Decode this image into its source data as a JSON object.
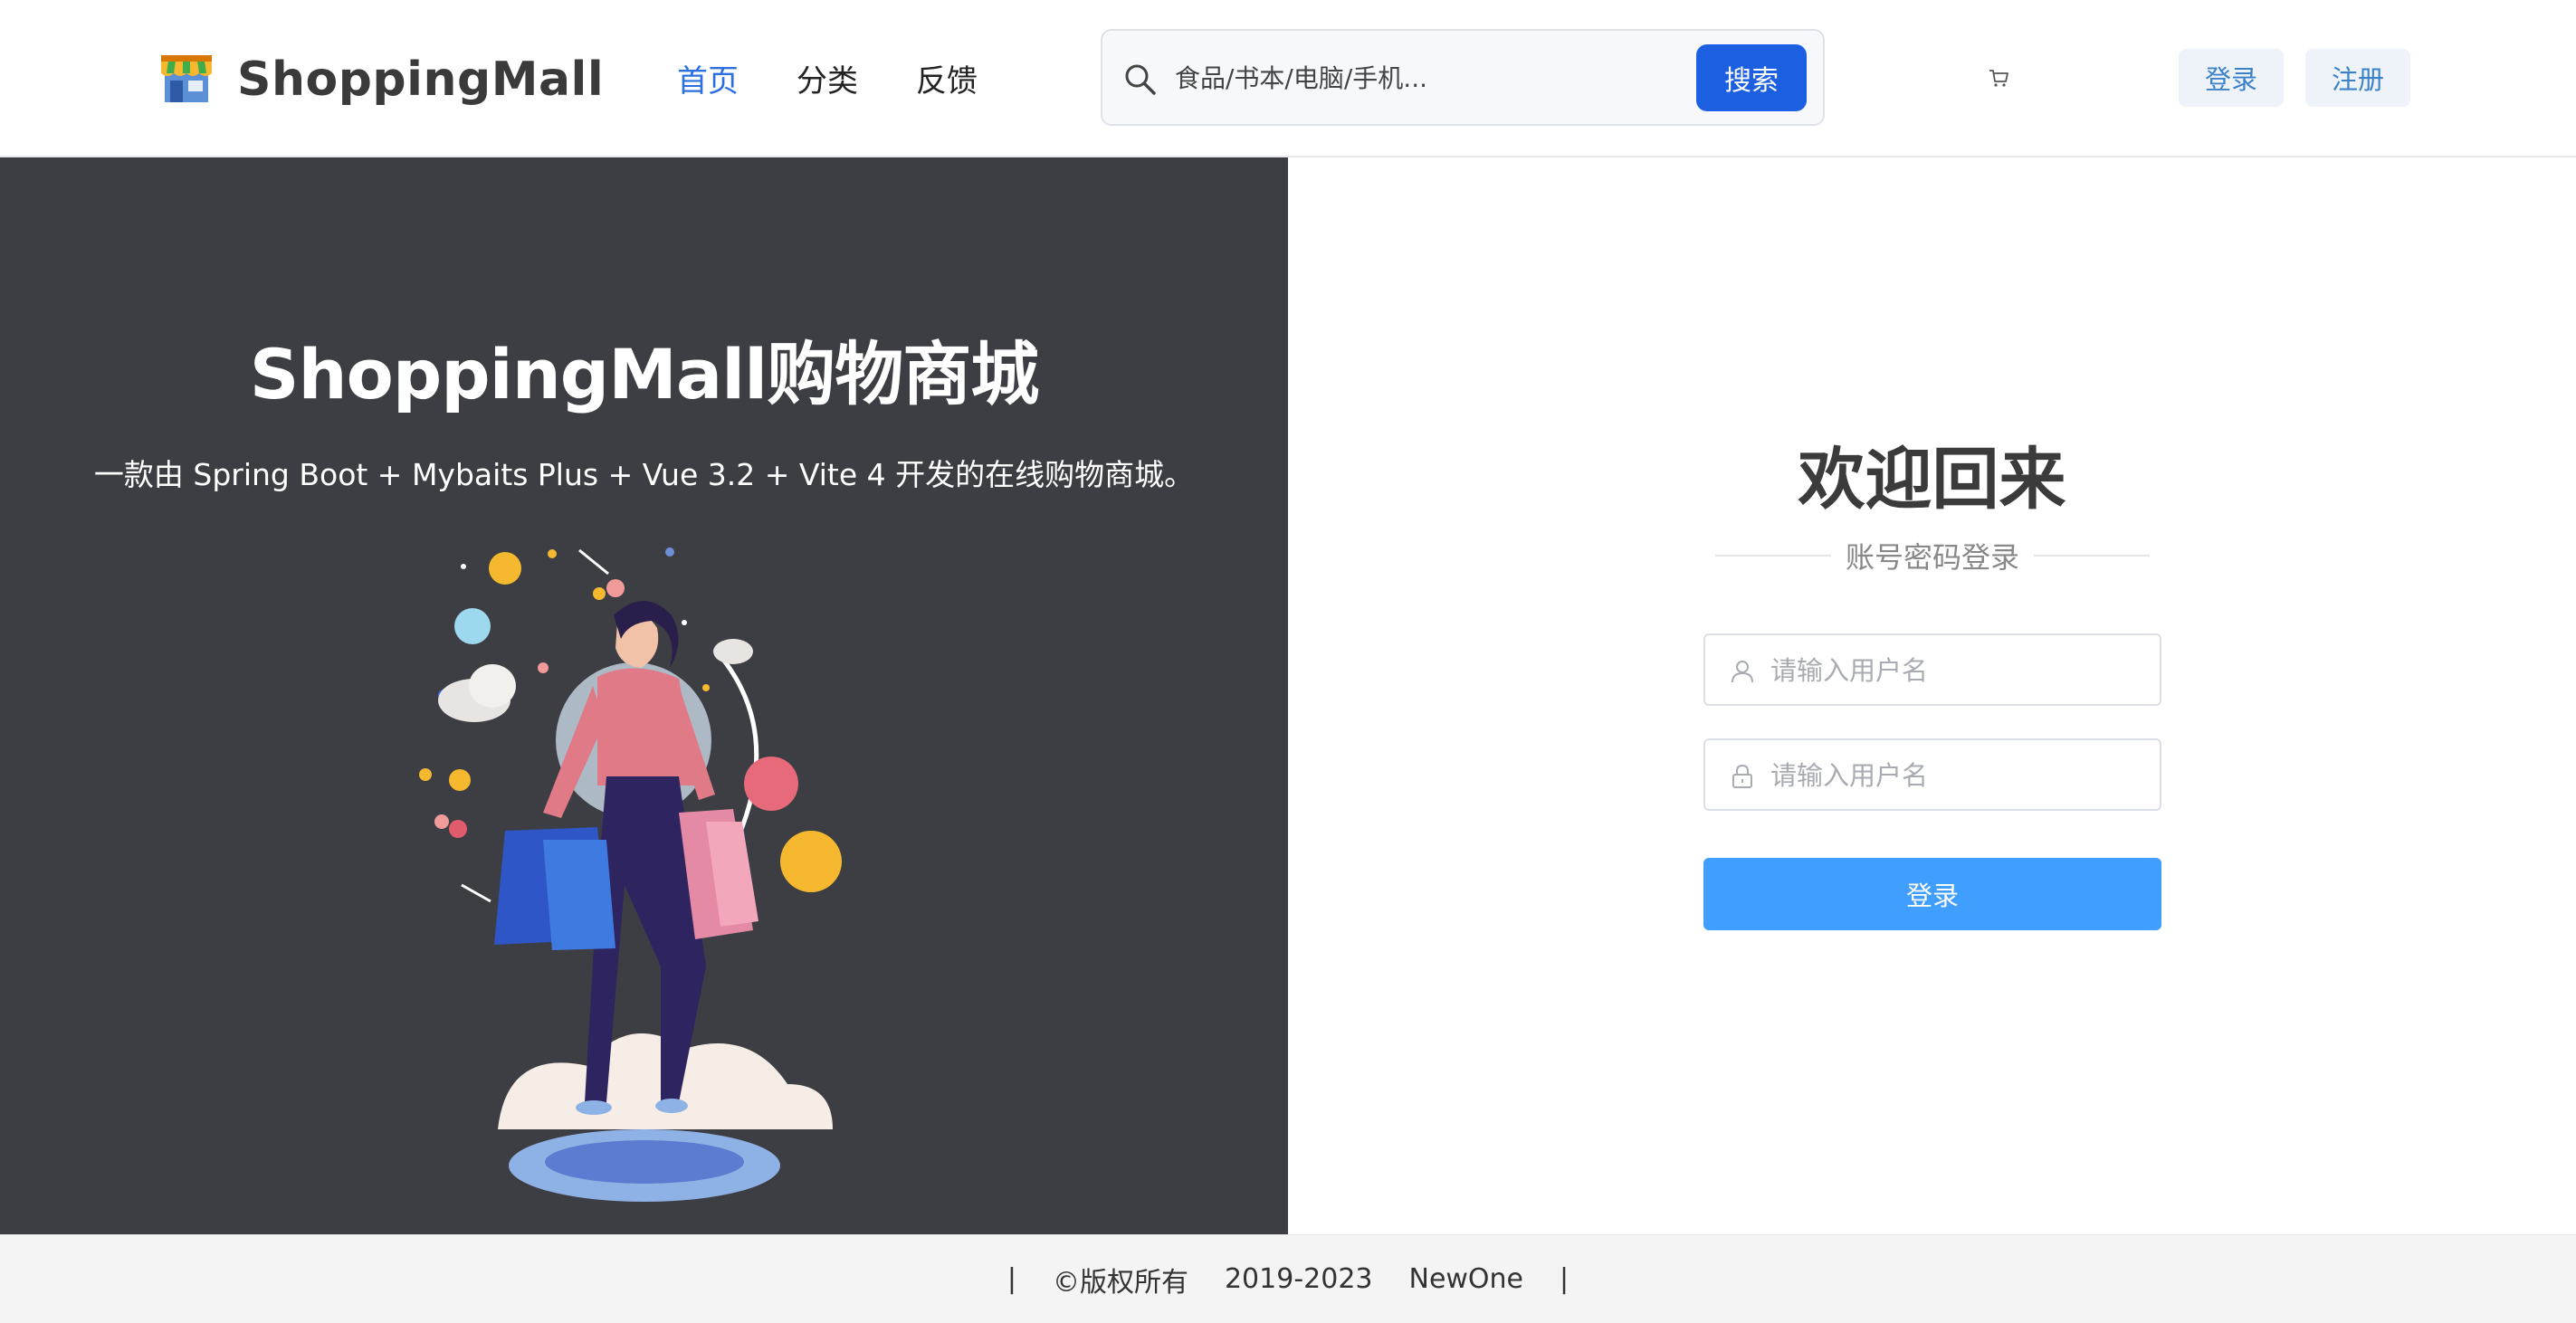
{
  "header": {
    "brand": "ShoppingMall",
    "nav": [
      {
        "label": "首页",
        "active": true
      },
      {
        "label": "分类",
        "active": false
      },
      {
        "label": "反馈",
        "active": false
      }
    ],
    "search": {
      "placeholder": "食品/书本/电脑/手机...",
      "button": "搜索"
    },
    "login_button": "登录",
    "register_button": "注册"
  },
  "hero": {
    "title": "ShoppingMall购物商城",
    "subtitle": "一款由 Spring Boot + Mybaits Plus + Vue 3.2 + Vite 4 开发的在线购物商城。"
  },
  "login": {
    "welcome": "欢迎回来",
    "method": "账号密码登录",
    "username_placeholder": "请输入用户名",
    "password_placeholder": "请输入用户名",
    "submit": "登录"
  },
  "footer": {
    "sep_left": "|",
    "copyright": "©版权所有",
    "years": "2019-2023",
    "owner": "NewOne",
    "sep_right": "|"
  },
  "colors": {
    "accent": "#1c5fe0",
    "nav_active": "#2b6fe0",
    "hero_bg": "#3d3e44",
    "login_button": "#409eff"
  },
  "icons": [
    "shop-logo-icon",
    "search-icon",
    "cart-icon",
    "user-icon",
    "lock-icon"
  ]
}
